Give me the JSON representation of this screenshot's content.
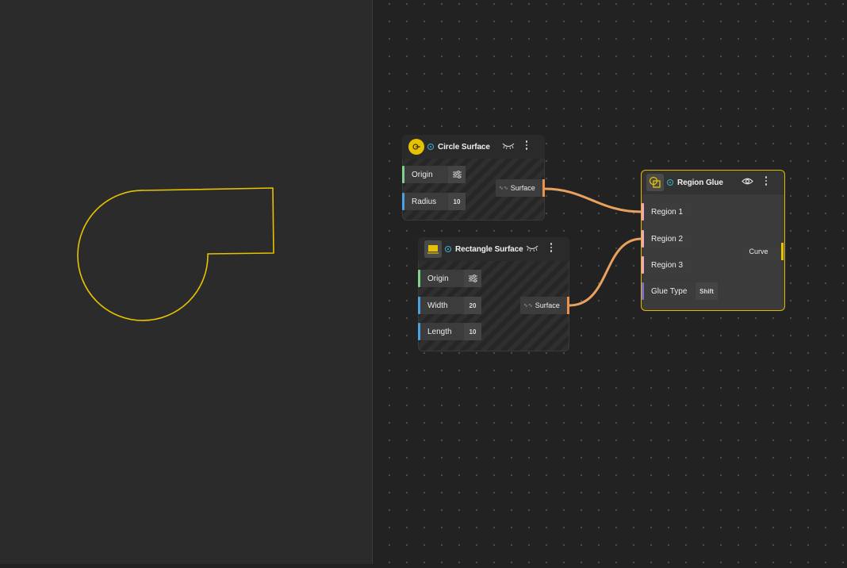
{
  "colors": {
    "accent_yellow": "#e6c200",
    "wire_orange": "#e8a15e",
    "port_green": "#7fd28a",
    "port_blue": "#4aa3df",
    "port_pink": "#f0a8c0",
    "port_purple": "#7b6fd6",
    "output_orange": "#e8924a"
  },
  "nodes": {
    "circle_surface": {
      "title": "Circle Surface",
      "icon": "circle-surface-icon",
      "inputs": [
        {
          "label": "Origin",
          "value_icon": "sliders-icon"
        },
        {
          "label": "Radius",
          "value": "10"
        }
      ],
      "output": "Surface"
    },
    "rectangle_surface": {
      "title": "Rectangle Surface",
      "icon": "rectangle-surface-icon",
      "inputs": [
        {
          "label": "Origin",
          "value_icon": "sliders-icon"
        },
        {
          "label": "Width",
          "value": "20"
        },
        {
          "label": "Length",
          "value": "10"
        }
      ],
      "output": "Surface"
    },
    "region_glue": {
      "title": "Region Glue",
      "icon": "region-glue-icon",
      "inputs": [
        {
          "label": "Region 1"
        },
        {
          "label": "Region 2"
        },
        {
          "label": "Region 3"
        },
        {
          "label": "Glue Type",
          "value": "Shift"
        }
      ],
      "output": "Curve"
    }
  }
}
